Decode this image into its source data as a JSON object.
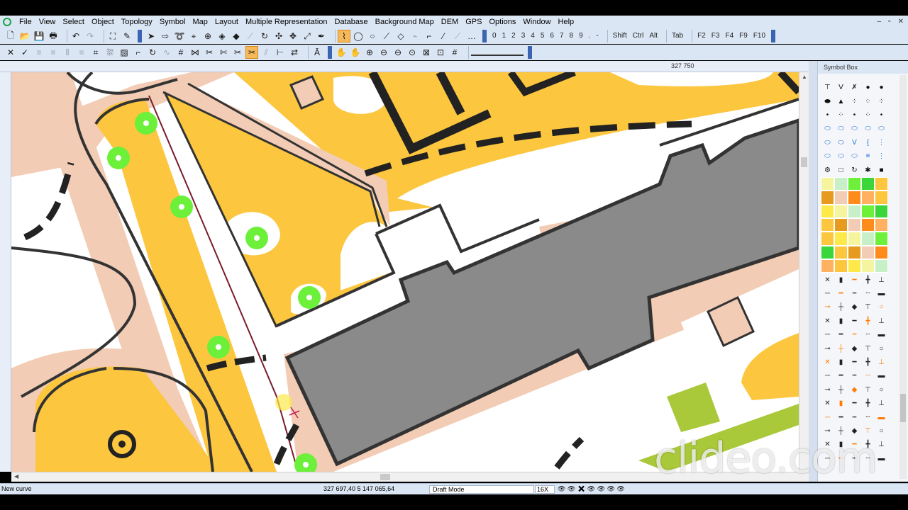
{
  "menubar": {
    "items": [
      "File",
      "View",
      "Select",
      "Object",
      "Topology",
      "Symbol",
      "Map",
      "Layout",
      "Multiple Representation",
      "Database",
      "Background Map",
      "DEM",
      "GPS",
      "Options",
      "Window",
      "Help"
    ],
    "underline": [
      "F",
      "V",
      "S",
      "O",
      "T",
      "y",
      "M",
      "L",
      "u",
      "D",
      "B",
      "E",
      "G",
      "O",
      "W",
      "H"
    ],
    "window_controls": [
      "–",
      "▫",
      "✕"
    ]
  },
  "toolbar1": {
    "number_keys": [
      "0",
      "1",
      "2",
      "3",
      "4",
      "5",
      "6",
      "7",
      "8",
      "9",
      ".",
      "-"
    ],
    "modifier_keys": [
      "Shift",
      "Ctrl",
      "Alt"
    ],
    "tab_key": "Tab",
    "function_keys": [
      "F2",
      "F3",
      "F4",
      "F9",
      "F10"
    ]
  },
  "ruler": {
    "coordinate": "327 750"
  },
  "symbol_box": {
    "title": "Symbol Box"
  },
  "status": {
    "action": "New curve",
    "coordinates": "327 697,40   5 147 065,64",
    "mode": "Draft Mode",
    "zoom": "16X"
  },
  "watermark": {
    "text": "clideo.com"
  },
  "colors": {
    "map_yellow": "#fcc63f",
    "map_tan": "#f2ccb4",
    "building_gray": "#8a8a8a",
    "green_point": "#6cf03a",
    "ui_blue": "#dbe6f4",
    "active_tool": "#f5b95a"
  }
}
